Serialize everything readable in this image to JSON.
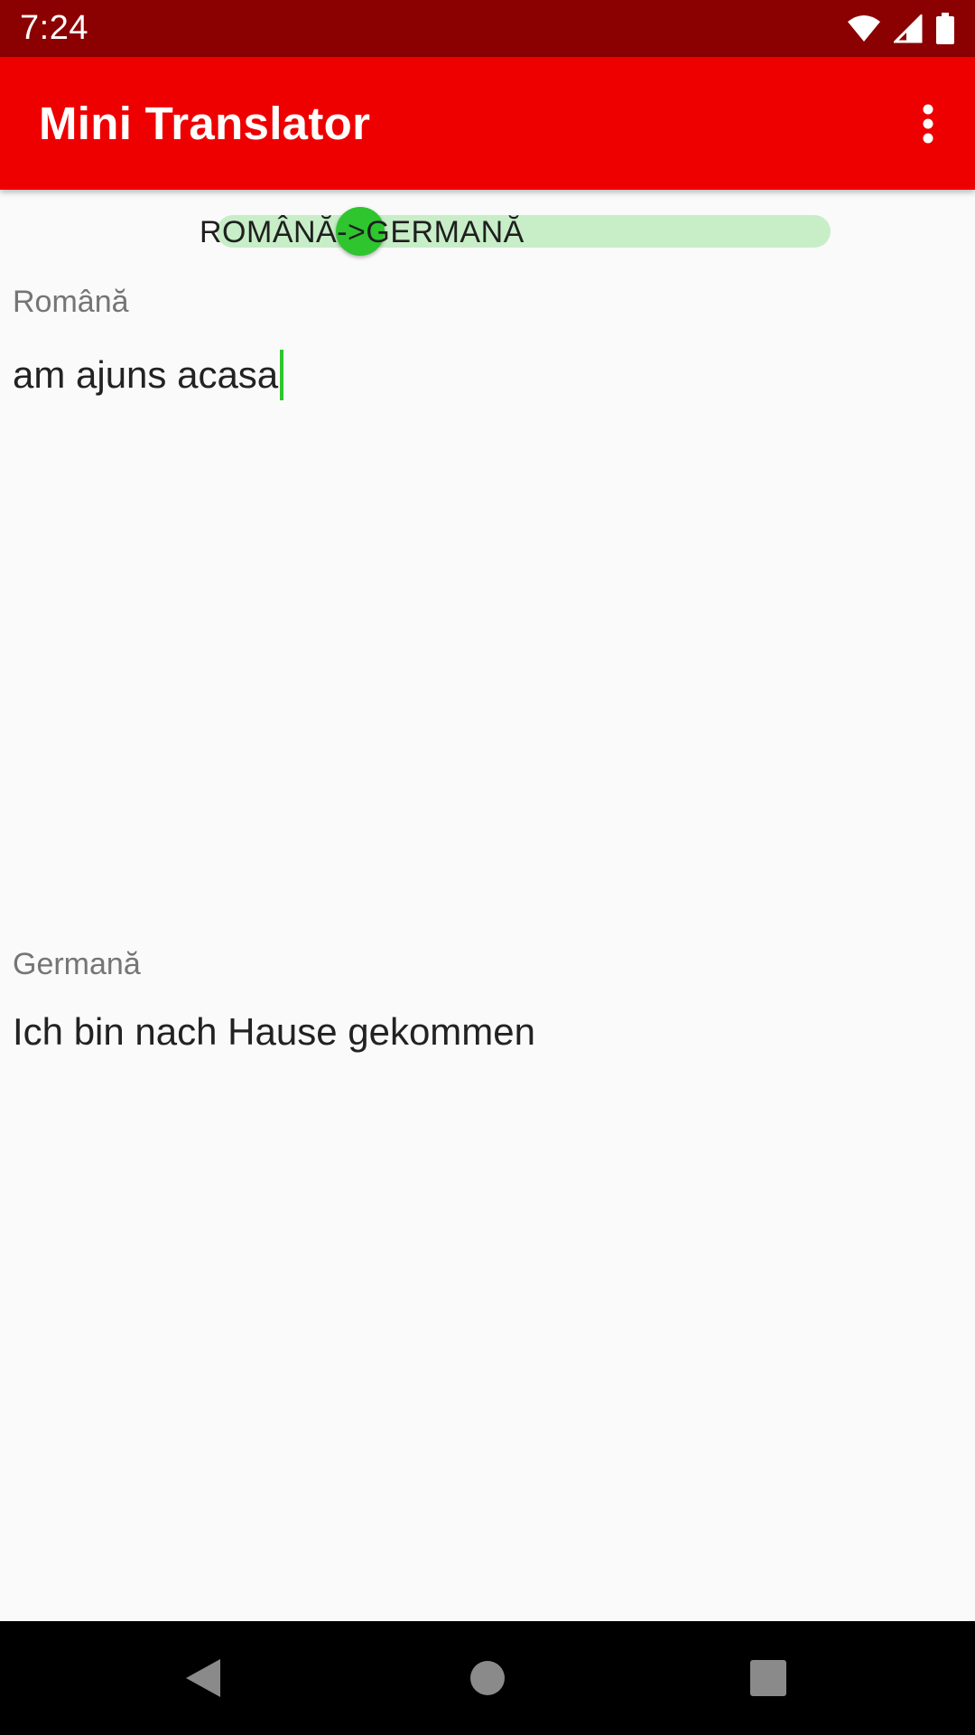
{
  "status_bar": {
    "time": "7:24",
    "icons": [
      "wifi-icon",
      "signal-icon",
      "battery-icon"
    ]
  },
  "app_bar": {
    "title": "Mini Translator",
    "menu_icon": "more-vert-icon"
  },
  "direction_switch": {
    "label": "ROMÂNĂ->GERMANĂ",
    "checked": true,
    "track_color": "#c8eec8",
    "thumb_color": "#2ec52e"
  },
  "source": {
    "label": "Română",
    "value": "am ajuns acasa"
  },
  "target": {
    "label": "Germană",
    "value": "Ich bin nach Hause gekommen"
  },
  "nav_bar": {
    "icons": [
      "back-icon",
      "home-icon",
      "recents-icon"
    ]
  },
  "colors": {
    "status_bar": "#8b0000",
    "app_bar": "#ee0000",
    "accent": "#2ec52e",
    "background": "#fafafa"
  }
}
